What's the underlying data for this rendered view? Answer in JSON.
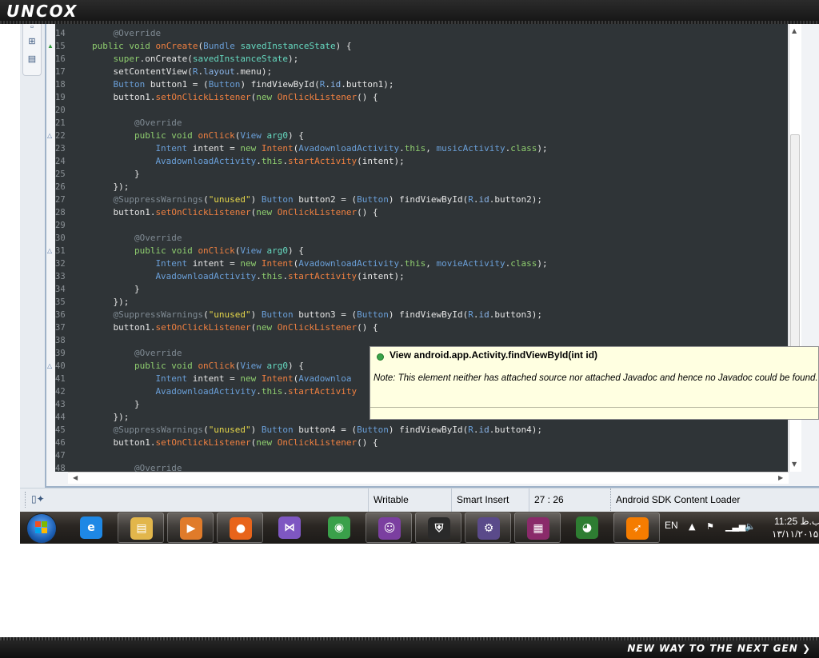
{
  "banner": {
    "logo": "UNCOX",
    "tagline": "NEW WAY TO THE NEXT GEN ❯"
  },
  "editor": {
    "lines": [
      {
        "n": "14",
        "t": [
          [
            "@Override",
            "ann",
            8
          ]
        ]
      },
      {
        "n": "15",
        "m": "up",
        "t": [
          [
            "public void ",
            "kw",
            4
          ],
          [
            "onCreate",
            "me"
          ],
          [
            "(",
            "p"
          ],
          [
            "Bundle ",
            "ty"
          ],
          [
            "savedInstanceState",
            "pa"
          ],
          [
            ") {",
            "p"
          ]
        ]
      },
      {
        "n": "16",
        "t": [
          [
            "super",
            "kw",
            8
          ],
          [
            ".onCreate(",
            "p"
          ],
          [
            "savedInstanceState",
            "pa"
          ],
          [
            ");",
            "p"
          ]
        ]
      },
      {
        "n": "17",
        "t": [
          [
            "setContentView(",
            "p",
            8
          ],
          [
            "R",
            "ty"
          ],
          [
            ".",
            "p"
          ],
          [
            "layout",
            "fi"
          ],
          [
            ".menu);",
            "p"
          ]
        ]
      },
      {
        "n": "18",
        "t": [
          [
            "Button ",
            "ty",
            8
          ],
          [
            "button1 = (",
            "p"
          ],
          [
            "Button",
            "ty"
          ],
          [
            ") findViewById(",
            "p"
          ],
          [
            "R",
            "ty"
          ],
          [
            ".",
            "p"
          ],
          [
            "id",
            "fi"
          ],
          [
            ".button1);",
            "p"
          ]
        ]
      },
      {
        "n": "19",
        "t": [
          [
            "button1.",
            "p",
            8
          ],
          [
            "setOnClickListener",
            "me"
          ],
          [
            "(",
            "p"
          ],
          [
            "new ",
            "kw"
          ],
          [
            "OnClickListener",
            "me"
          ],
          [
            "() {",
            "p"
          ]
        ]
      },
      {
        "n": "20",
        "t": []
      },
      {
        "n": "21",
        "t": [
          [
            "@Override",
            "ann",
            12
          ]
        ]
      },
      {
        "n": "22",
        "m": "ov",
        "t": [
          [
            "public void ",
            "kw",
            12
          ],
          [
            "onClick",
            "me"
          ],
          [
            "(",
            "p"
          ],
          [
            "View ",
            "ty"
          ],
          [
            "arg0",
            "pa"
          ],
          [
            ") {",
            "p"
          ]
        ]
      },
      {
        "n": "23",
        "t": [
          [
            "Intent ",
            "ty",
            16
          ],
          [
            "intent = ",
            "p"
          ],
          [
            "new ",
            "kw"
          ],
          [
            "Intent",
            "me"
          ],
          [
            "(",
            "p"
          ],
          [
            "AvadownloadActivity",
            "ty"
          ],
          [
            ".",
            "p"
          ],
          [
            "this",
            "kw"
          ],
          [
            ", ",
            "p"
          ],
          [
            "musicActivity",
            "ty"
          ],
          [
            ".",
            "p"
          ],
          [
            "class",
            "kw"
          ],
          [
            ");",
            "p"
          ]
        ]
      },
      {
        "n": "24",
        "t": [
          [
            "AvadownloadActivity",
            "ty",
            16
          ],
          [
            ".",
            "p"
          ],
          [
            "this",
            "kw"
          ],
          [
            ".",
            "p"
          ],
          [
            "startActivity",
            "me"
          ],
          [
            "(intent);",
            "p"
          ]
        ]
      },
      {
        "n": "25",
        "t": [
          [
            "}",
            "p",
            12
          ]
        ]
      },
      {
        "n": "26",
        "t": [
          [
            "});",
            "p",
            8
          ]
        ]
      },
      {
        "n": "27",
        "t": [
          [
            "@SuppressWarnings",
            "ann",
            8
          ],
          [
            "(",
            "p"
          ],
          [
            "\"unused\"",
            "st"
          ],
          [
            ") ",
            "p"
          ],
          [
            "Button ",
            "ty"
          ],
          [
            "button2 = (",
            "p"
          ],
          [
            "Button",
            "ty"
          ],
          [
            ") findViewById(",
            "p"
          ],
          [
            "R",
            "ty"
          ],
          [
            ".",
            "p"
          ],
          [
            "id",
            "fi"
          ],
          [
            ".button2);",
            "p"
          ]
        ]
      },
      {
        "n": "28",
        "t": [
          [
            "button1.",
            "p",
            8
          ],
          [
            "setOnClickListener",
            "me"
          ],
          [
            "(",
            "p"
          ],
          [
            "new ",
            "kw"
          ],
          [
            "OnClickListener",
            "me"
          ],
          [
            "() {",
            "p"
          ]
        ]
      },
      {
        "n": "29",
        "t": []
      },
      {
        "n": "30",
        "t": [
          [
            "@Override",
            "ann",
            12
          ]
        ]
      },
      {
        "n": "31",
        "m": "ov",
        "t": [
          [
            "public void ",
            "kw",
            12
          ],
          [
            "onClick",
            "me"
          ],
          [
            "(",
            "p"
          ],
          [
            "View ",
            "ty"
          ],
          [
            "arg0",
            "pa"
          ],
          [
            ") {",
            "p"
          ]
        ]
      },
      {
        "n": "32",
        "t": [
          [
            "Intent ",
            "ty",
            16
          ],
          [
            "intent = ",
            "p"
          ],
          [
            "new ",
            "kw"
          ],
          [
            "Intent",
            "me"
          ],
          [
            "(",
            "p"
          ],
          [
            "AvadownloadActivity",
            "ty"
          ],
          [
            ".",
            "p"
          ],
          [
            "this",
            "kw"
          ],
          [
            ", ",
            "p"
          ],
          [
            "movieActivity",
            "ty"
          ],
          [
            ".",
            "p"
          ],
          [
            "class",
            "kw"
          ],
          [
            ");",
            "p"
          ]
        ]
      },
      {
        "n": "33",
        "t": [
          [
            "AvadownloadActivity",
            "ty",
            16
          ],
          [
            ".",
            "p"
          ],
          [
            "this",
            "kw"
          ],
          [
            ".",
            "p"
          ],
          [
            "startActivity",
            "me"
          ],
          [
            "(intent);",
            "p"
          ]
        ]
      },
      {
        "n": "34",
        "t": [
          [
            "}",
            "p",
            12
          ]
        ]
      },
      {
        "n": "35",
        "t": [
          [
            "});",
            "p",
            8
          ]
        ]
      },
      {
        "n": "36",
        "t": [
          [
            "@SuppressWarnings",
            "ann",
            8
          ],
          [
            "(",
            "p"
          ],
          [
            "\"unused\"",
            "st"
          ],
          [
            ") ",
            "p"
          ],
          [
            "Button ",
            "ty"
          ],
          [
            "button3 = (",
            "p"
          ],
          [
            "Button",
            "ty"
          ],
          [
            ") findViewById(",
            "p"
          ],
          [
            "R",
            "ty"
          ],
          [
            ".",
            "p"
          ],
          [
            "id",
            "fi"
          ],
          [
            ".button3);",
            "p"
          ]
        ]
      },
      {
        "n": "37",
        "t": [
          [
            "button1.",
            "p",
            8
          ],
          [
            "setOnClickListener",
            "me"
          ],
          [
            "(",
            "p"
          ],
          [
            "new ",
            "kw"
          ],
          [
            "OnClickListener",
            "me"
          ],
          [
            "() {",
            "p"
          ]
        ]
      },
      {
        "n": "38",
        "t": []
      },
      {
        "n": "39",
        "t": [
          [
            "@Override",
            "ann",
            12
          ]
        ]
      },
      {
        "n": "40",
        "m": "ov",
        "t": [
          [
            "public void ",
            "kw",
            12
          ],
          [
            "onClick",
            "me"
          ],
          [
            "(",
            "p"
          ],
          [
            "View ",
            "ty"
          ],
          [
            "arg0",
            "pa"
          ],
          [
            ") {",
            "p"
          ]
        ]
      },
      {
        "n": "41",
        "t": [
          [
            "Intent ",
            "ty",
            16
          ],
          [
            "intent = ",
            "p"
          ],
          [
            "new ",
            "kw"
          ],
          [
            "Intent",
            "me"
          ],
          [
            "(",
            "p"
          ],
          [
            "Avadownloa",
            "ty"
          ]
        ]
      },
      {
        "n": "42",
        "t": [
          [
            "AvadownloadActivity",
            "ty",
            16
          ],
          [
            ".",
            "p"
          ],
          [
            "this",
            "kw"
          ],
          [
            ".",
            "p"
          ],
          [
            "startActivity",
            "me"
          ]
        ]
      },
      {
        "n": "43",
        "t": [
          [
            "}",
            "p",
            12
          ]
        ]
      },
      {
        "n": "44",
        "t": [
          [
            "});",
            "p",
            8
          ]
        ]
      },
      {
        "n": "45",
        "t": [
          [
            "@SuppressWarnings",
            "ann",
            8
          ],
          [
            "(",
            "p"
          ],
          [
            "\"unused\"",
            "st"
          ],
          [
            ") ",
            "p"
          ],
          [
            "Button ",
            "ty"
          ],
          [
            "button4 = (",
            "p"
          ],
          [
            "Button",
            "ty"
          ],
          [
            ") findViewById(",
            "p"
          ],
          [
            "R",
            "ty"
          ],
          [
            ".",
            "p"
          ],
          [
            "id",
            "fi"
          ],
          [
            ".button4);",
            "p"
          ]
        ]
      },
      {
        "n": "46",
        "t": [
          [
            "button1.",
            "p",
            8
          ],
          [
            "setOnClickListener",
            "me"
          ],
          [
            "(",
            "p"
          ],
          [
            "new ",
            "kw"
          ],
          [
            "OnClickListener",
            "me"
          ],
          [
            "() {",
            "p"
          ]
        ]
      },
      {
        "n": "47",
        "t": []
      },
      {
        "n": "48",
        "t": [
          [
            "@Override",
            "ann",
            12
          ]
        ]
      }
    ],
    "syntax_colors": {
      "kw": "#8fce6f",
      "me": "#f08040",
      "ty": "#6a9fd8",
      "pa": "#66d9c0",
      "ann": "#7f8a93",
      "st": "#e6d74a",
      "fi": "#8ab4e8",
      "p": "#e6e6e6"
    }
  },
  "tooltip": {
    "title": "View android.app.Activity.findViewById(int id)",
    "note": "Note: This element neither has attached source nor attached Javadoc and hence no Javadoc could be found."
  },
  "statusbar": {
    "mode": "Writable",
    "insert": "Smart Insert",
    "position": "27 : 26",
    "task": "Android SDK Content Loader"
  },
  "taskbar": {
    "apps": [
      {
        "name": "internet-explorer-icon",
        "glyph": "e",
        "color": "#1e88e5",
        "pinned": false
      },
      {
        "name": "file-explorer-icon",
        "glyph": "▤",
        "color": "#e2b64b",
        "pinned": true
      },
      {
        "name": "media-player-icon",
        "glyph": "▶",
        "color": "#e07b2a",
        "pinned": true
      },
      {
        "name": "firefox-icon",
        "glyph": "●",
        "color": "#e8641b",
        "pinned": true
      },
      {
        "name": "visual-studio-icon",
        "glyph": "⋈",
        "color": "#7e57c2",
        "pinned": false
      },
      {
        "name": "chrome-icon",
        "glyph": "◉",
        "color": "#3aa04a",
        "pinned": false
      },
      {
        "name": "yahoo-messenger-icon",
        "glyph": "☺",
        "color": "#7b3fa0",
        "pinned": true
      },
      {
        "name": "security-shield-icon",
        "glyph": "⛨",
        "color": "#2a2a2a",
        "pinned": true
      },
      {
        "name": "eclipse-ide-icon",
        "glyph": "⚙",
        "color": "#5a4a8a",
        "pinned": true
      },
      {
        "name": "winrar-icon",
        "glyph": "▦",
        "color": "#8a2a6a",
        "pinned": true
      },
      {
        "name": "download-manager-icon",
        "glyph": "◕",
        "color": "#2e7d32",
        "pinned": false
      },
      {
        "name": "flashget-icon",
        "glyph": "➶",
        "color": "#f57c00",
        "pinned": true
      }
    ],
    "language": "EN",
    "time": "11:25 ب.ظ",
    "date": "۱۳/۱۱/۲۰۱۵"
  }
}
